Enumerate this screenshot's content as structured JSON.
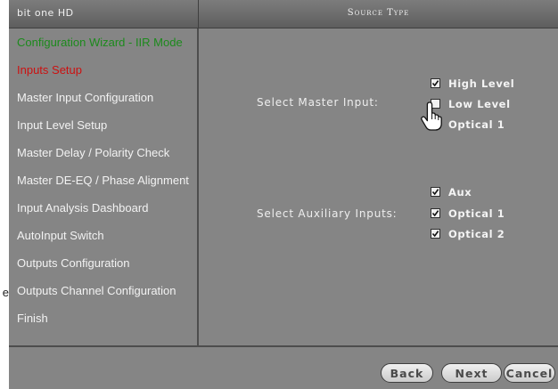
{
  "header": {
    "app_title": "bit one HD",
    "section_title": "Source Type"
  },
  "sidebar": {
    "items": [
      {
        "label": "Configuration Wizard - IIR Mode",
        "state": "done"
      },
      {
        "label": "Inputs Setup",
        "state": "active"
      },
      {
        "label": "Master Input Configuration",
        "state": "normal"
      },
      {
        "label": "Input Level Setup",
        "state": "normal"
      },
      {
        "label": "Master Delay / Polarity Check",
        "state": "normal"
      },
      {
        "label": "Master DE-EQ / Phase Alignment",
        "state": "normal"
      },
      {
        "label": "Input Analysis Dashboard",
        "state": "normal"
      },
      {
        "label": "AutoInput Switch",
        "state": "normal"
      },
      {
        "label": "Outputs Configuration",
        "state": "normal"
      },
      {
        "label": "Outputs Channel Configuration",
        "state": "normal"
      },
      {
        "label": "Finish",
        "state": "normal"
      }
    ]
  },
  "master_input": {
    "label": "Select Master Input:",
    "options": [
      {
        "label": "High Level",
        "checked": true
      },
      {
        "label": "Low Level",
        "checked": false
      },
      {
        "label": "Optical 1",
        "checked": false
      }
    ]
  },
  "auxiliary_inputs": {
    "label": "Select Auxiliary Inputs:",
    "options": [
      {
        "label": "Aux",
        "checked": true
      },
      {
        "label": "Optical 1",
        "checked": true
      },
      {
        "label": "Optical 2",
        "checked": true
      }
    ]
  },
  "footer": {
    "back_label": "Back",
    "next_label": "Next",
    "cancel_label": "Cancel"
  },
  "edge_text": "e",
  "colors": {
    "panel_bg": "#858585",
    "done_item": "#1c8a1c",
    "active_item": "#cc1111"
  }
}
